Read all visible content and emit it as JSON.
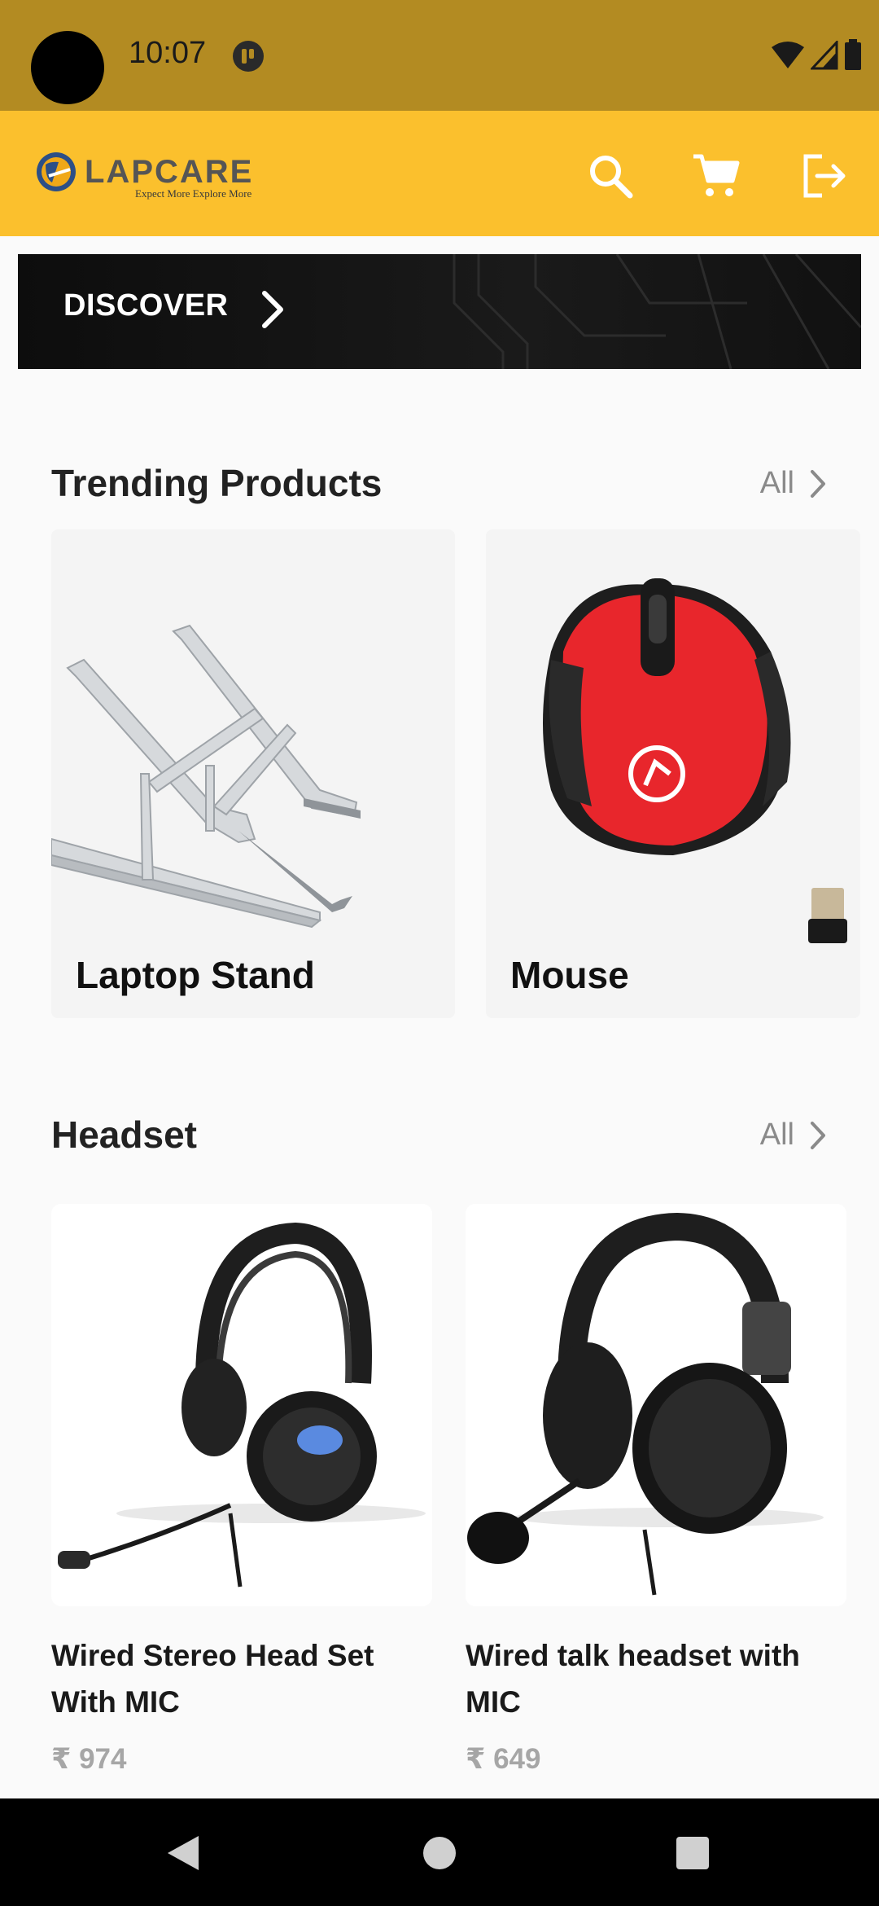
{
  "status_bar": {
    "time": "10:07"
  },
  "app_bar": {
    "brand": "LAPCARE",
    "tagline": "Expect More Explore More",
    "icons": [
      "search-icon",
      "cart-icon",
      "logout-icon"
    ]
  },
  "banner": {
    "label": "DISCOVER"
  },
  "trending": {
    "title": "Trending Products",
    "all_label": "All",
    "items": [
      {
        "label": "Laptop Stand"
      },
      {
        "label": "Mouse"
      }
    ]
  },
  "headset": {
    "title": "Headset",
    "all_label": "All",
    "products": [
      {
        "name": "Wired Stereo Head Set With MIC",
        "price": "₹ 974"
      },
      {
        "name": "Wired talk headset with MIC",
        "price": "₹ 649"
      }
    ]
  },
  "colors": {
    "status_bar": "#b38b22",
    "app_bar": "#fbc02d",
    "mouse_red": "#e8262c"
  }
}
